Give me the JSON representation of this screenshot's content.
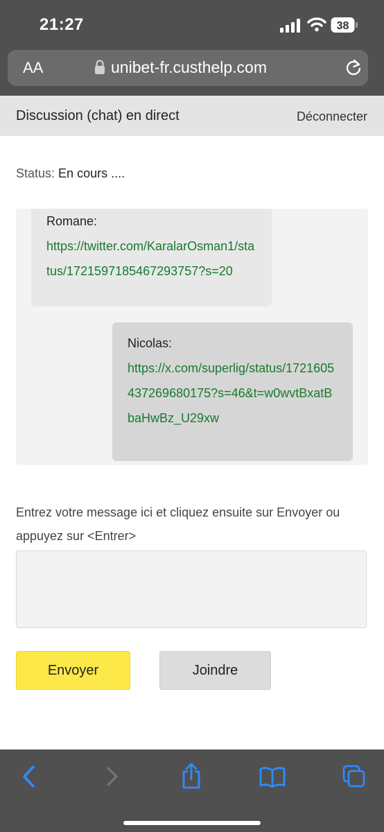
{
  "status_bar": {
    "time": "21:27",
    "battery": "38",
    "icons": [
      "signal-icon",
      "wifi-icon",
      "battery-icon"
    ]
  },
  "address_bar": {
    "text_size_label": "AA",
    "url": "unibet-fr.custhelp.com",
    "icons": [
      "lock-icon",
      "reload-icon"
    ]
  },
  "header": {
    "title": "Discussion (chat) en direct",
    "disconnect": "Déconnecter"
  },
  "status": {
    "label": "Status:",
    "value": "En cours ...."
  },
  "chat": {
    "messages": [
      {
        "author": "Romane:",
        "text": "https://twitter.com/KaralarOsman1/status/1721597185467293757?s=20"
      },
      {
        "author": "Nicolas:",
        "text": "https://x.com/superlig/status/1721605437269680175?s=46&t=w0wvtBxatBbaHwBz_U29xw"
      }
    ]
  },
  "composer": {
    "instructions": "Entrez votre message ici et cliquez ensuite sur Envoyer ou appuyez sur <Entrer>",
    "value": "",
    "send_label": "Envoyer",
    "attach_label": "Joindre"
  },
  "toolbar": {
    "icons": [
      "back-icon",
      "forward-icon",
      "share-icon",
      "bookmarks-icon",
      "tabs-icon"
    ]
  },
  "colors": {
    "browser_chrome": "#505050",
    "link": "#187a2d",
    "send_button": "#fde84a",
    "accent_blue": "#2f8bff"
  }
}
